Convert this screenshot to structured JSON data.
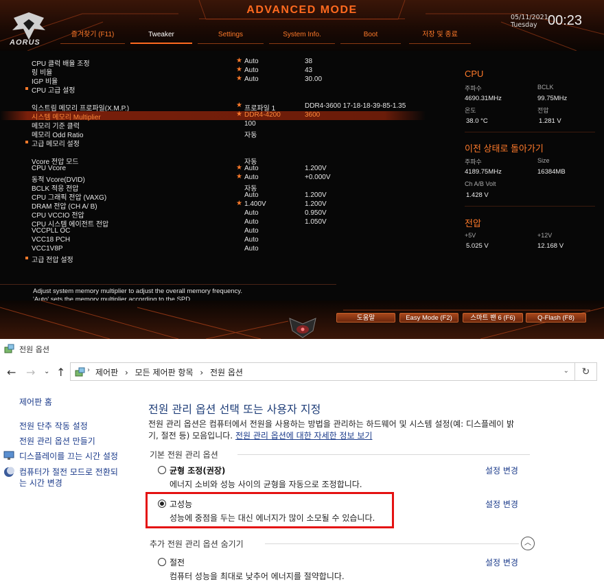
{
  "bios": {
    "title": "ADVANCED MODE",
    "logo_text": "AORUS",
    "date": "05/11/2021",
    "day": "Tuesday",
    "time": "00:23",
    "tabs": [
      "즐겨찾기 (F11)",
      "Tweaker",
      "Settings",
      "System Info.",
      "Boot",
      "저장 및 종료"
    ],
    "active_tab": "Tweaker",
    "settings": [
      {
        "label": "CPU 클럭 배율 조정",
        "star": true,
        "v1": "Auto",
        "v2": "38"
      },
      {
        "label": "링 비율",
        "star": true,
        "v1": "Auto",
        "v2": "43"
      },
      {
        "label": "IGP 비율",
        "star": true,
        "v1": "Auto",
        "v2": "30.00"
      },
      {
        "label": "CPU 고급 설정",
        "bullet": true
      },
      {
        "label": "익스트림 메모리 프로파일(X.M.P.)",
        "star": true,
        "v1": "프로파일 1",
        "v2": "DDR4-3600 17-18-18-39-85-1.35"
      },
      {
        "label": "시스템 메모리 Multiplier",
        "star": true,
        "v1": "DDR4-4200",
        "v2": "3600",
        "highlight": true
      },
      {
        "label": "메모리 기준 클럭",
        "v1": "100"
      },
      {
        "label": "메모리 Odd Ratio",
        "v1": "자동"
      },
      {
        "label": "고급 메모리 설정",
        "bullet": true
      },
      {
        "label": "Vcore 전압 모드",
        "v1": "자동"
      },
      {
        "label": "CPU Vcore",
        "star": true,
        "v1": "Auto",
        "v2": "1.200V"
      },
      {
        "label": "동적 Vcore(DVID)",
        "star": true,
        "v1": "Auto",
        "v2": "+0.000V"
      },
      {
        "label": "BCLK 적응 전압",
        "v1": "자동"
      },
      {
        "label": "CPU 그래픽 전압 (VAXG)",
        "v1": "Auto",
        "v2": "1.200V"
      },
      {
        "label": "DRAM 전압 (CH A/ B)",
        "star": true,
        "v1": "1.400V",
        "v2": "1.200V"
      },
      {
        "label": "CPU VCCIO 전압",
        "v1": "Auto",
        "v2": "0.950V"
      },
      {
        "label": "CPU 시스템 에이전트 전압",
        "v1": "Auto",
        "v2": "1.050V"
      },
      {
        "label": "VCCPLL OC",
        "v1": "Auto"
      },
      {
        "label": "VCC18 PCH",
        "v1": "Auto"
      },
      {
        "label": "VCC1V8P",
        "v1": "Auto"
      },
      {
        "label": "고급 전압 설정",
        "bullet": true
      }
    ],
    "cpu": {
      "heading": "CPU",
      "freq_label": "주파수",
      "freq": "4690.31MHz",
      "bclk_label": "BCLK",
      "bclk": "99.75MHz",
      "temp_label": "온도",
      "temp": "38.0 °C",
      "volt_label": "전압",
      "volt": "1.281 V"
    },
    "memory": {
      "heading": "이전 상태로 돌아가기",
      "freq_label": "주파수",
      "freq": "4189.75MHz",
      "size_label": "Size",
      "size": "16384MB",
      "chab_label": "Ch A/B Volt",
      "chab": "1.428 V"
    },
    "voltage": {
      "heading": "전압",
      "p5_label": "+5V",
      "p5": "5.025 V",
      "p12_label": "+12V",
      "p12": "12.168 V"
    },
    "help_line1": "Adjust system memory multiplier to adjust the overall memory frequency.",
    "help_line2": "'Auto' sets the memory multiplier according to the SPD",
    "buttons": [
      "도움말",
      "Easy Mode (F2)",
      "스마트 팬 6 (F6)",
      "Q-Flash (F8)"
    ],
    "colors": {
      "accent": "#ff6a1f",
      "highlight": "#7a1f0a"
    }
  },
  "control_panel": {
    "window_title": "전원 옵션",
    "breadcrumb": [
      "제어판",
      "모든 제어판 항목",
      "전원 옵션"
    ],
    "sidebar": {
      "home": "제어판 홈",
      "links": [
        "전원 단추 작동 설정",
        "전원 관리 옵션 만들기",
        "디스플레이를 끄는 시간 설정",
        "컴퓨터가 절전 모드로 전환되",
        "는 시간 변경"
      ]
    },
    "heading": "전원 관리 옵션 선택 또는 사용자 지정",
    "desc_line1": "전원 관리 옵션은 컴퓨터에서 전원을 사용하는 방법을 관리하는 하드웨어 및 시스템 설정(예: 디스플레이 밝",
    "desc_line2_prefix": "기, 절전 등) 모음입니다. ",
    "desc_link": "전원 관리 옵션에 대한 자세한 정보 보기",
    "group_label": "기본 전원 관리 옵션",
    "hidden_group_label": "추가 전원 관리 옵션 숨기기",
    "change_label": "설정 변경",
    "plans": [
      {
        "name": "균형 조정(권장)",
        "desc": "에너지 소비와 성능 사이의 균형을 자동으로 조정합니다.",
        "selected": false
      },
      {
        "name": "고성능",
        "desc": "성능에 중점을 두는 대신 에너지가 많이 소모될 수 있습니다.",
        "selected": true
      },
      {
        "name": "절전",
        "desc": "컴퓨터 성능을 최대로 낮추어 에너지를 절약합니다.",
        "selected": false
      }
    ],
    "colors": {
      "link": "#1a3a8a",
      "heading": "#1e3d78",
      "callout": "#e41111"
    }
  }
}
